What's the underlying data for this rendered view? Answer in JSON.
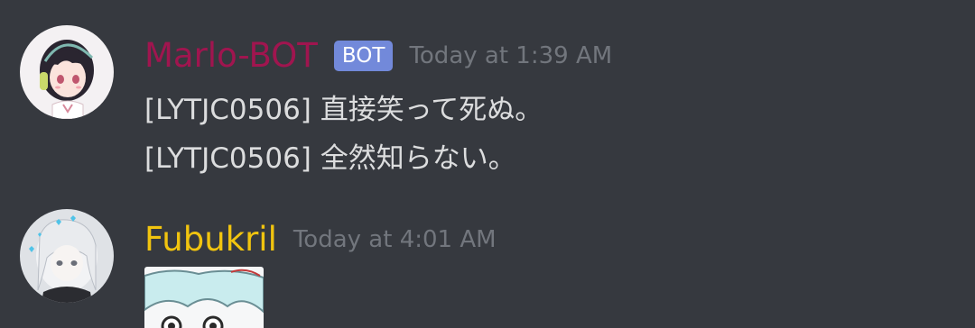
{
  "messages": [
    {
      "author": "Marlo-BOT",
      "author_color": "#a0154f",
      "bot_tag": "BOT",
      "timestamp": "Today at 1:39 AM",
      "lines": [
        "[LYTJC0506] 直接笑って死ぬ。",
        "[LYTJC0506] 全然知らない。"
      ],
      "avatar_icon": "anime-girl-avatar"
    },
    {
      "author": "Fubukril",
      "author_color": "#f1c40f",
      "timestamp": "Today at 4:01 AM",
      "avatar_icon": "anime-girl-white-hair-avatar",
      "attachment_icon": "image-attachment"
    }
  ],
  "colors": {
    "background": "#36393f",
    "timestamp": "#72767d",
    "text": "#dcddde",
    "bot_tag_bg": "#7289da"
  }
}
